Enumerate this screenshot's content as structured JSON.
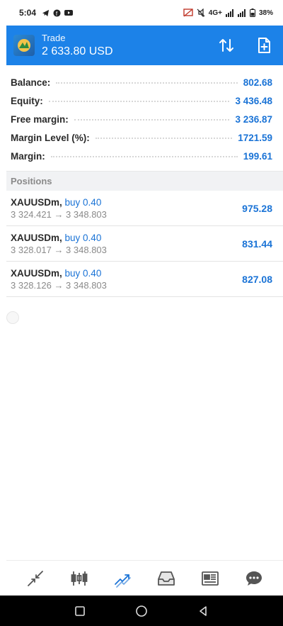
{
  "status_bar": {
    "time": "5:04",
    "network": "4G+",
    "battery": "38%"
  },
  "header": {
    "title": "Trade",
    "balance_display": "2 633.80 USD",
    "accent_color": "#1c82e8"
  },
  "summary": [
    {
      "label": "Balance:",
      "value": "802.68"
    },
    {
      "label": "Equity:",
      "value": "3 436.48"
    },
    {
      "label": "Free margin:",
      "value": "3 236.87"
    },
    {
      "label": "Margin Level (%):",
      "value": "1721.59"
    },
    {
      "label": "Margin:",
      "value": "199.61"
    }
  ],
  "positions_header": "Positions",
  "positions": [
    {
      "symbol": "XAUUSDm,",
      "side": "buy 0.40",
      "prices": "3 324.421 → 3 348.803",
      "profit": "975.28"
    },
    {
      "symbol": "XAUUSDm,",
      "side": "buy 0.40",
      "prices": "3 328.017 → 3 348.803",
      "profit": "831.44"
    },
    {
      "symbol": "XAUUSDm,",
      "side": "buy 0.40",
      "prices": "3 328.126 → 3 348.803",
      "profit": "827.08"
    }
  ],
  "icons": {
    "header": [
      "sort-icon",
      "new-order-icon"
    ],
    "nav": [
      "quotes-icon",
      "chart-icon",
      "trade-icon",
      "history-icon",
      "news-icon",
      "messages-icon"
    ],
    "system": [
      "recents-icon",
      "home-icon",
      "back-icon"
    ]
  }
}
